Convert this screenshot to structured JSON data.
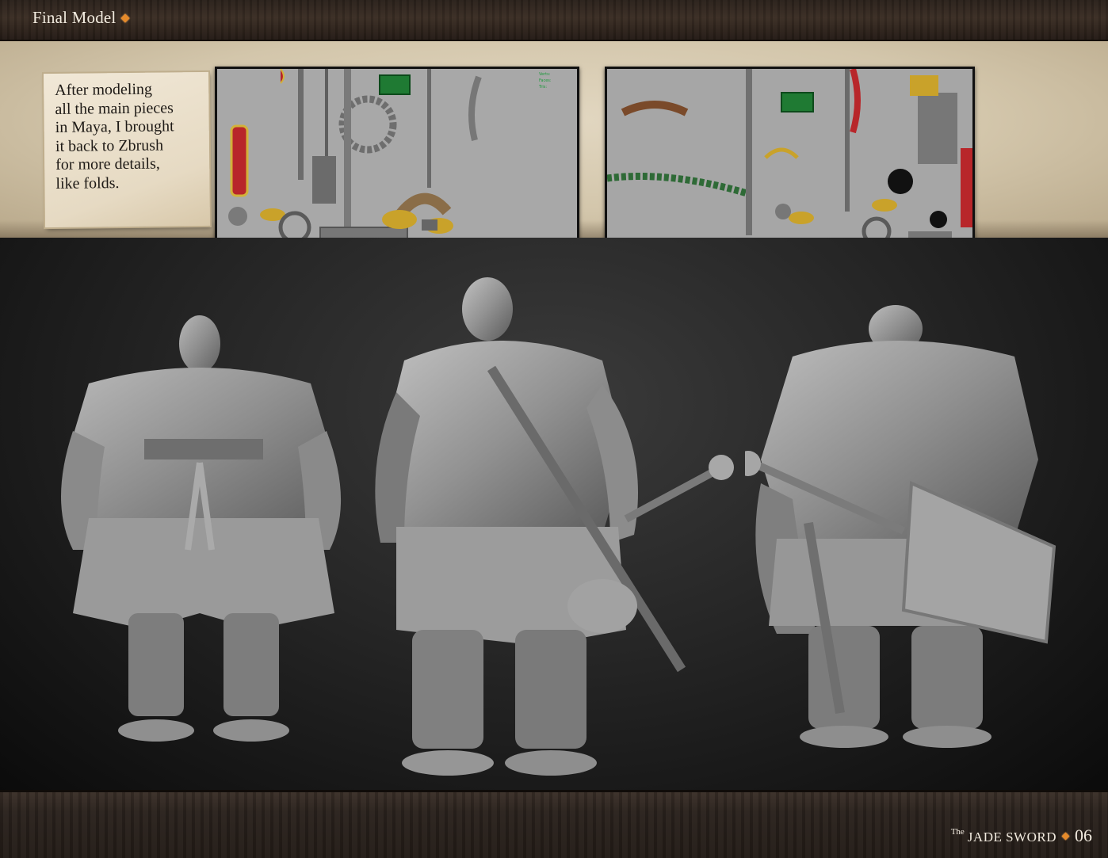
{
  "header": {
    "title": "Final Model"
  },
  "note": {
    "lines": [
      "After modeling",
      "all the main pieces",
      "in Maya, I brought",
      "it back to Zbrush",
      "for more details,",
      "like folds."
    ]
  },
  "footer": {
    "prefix": "The",
    "brand": "JADE SWORD",
    "page": "06"
  },
  "colors": {
    "accent": "#e58a2a",
    "parchment": "#d8ccb2",
    "viewport_bg": "#a9a9a9"
  }
}
